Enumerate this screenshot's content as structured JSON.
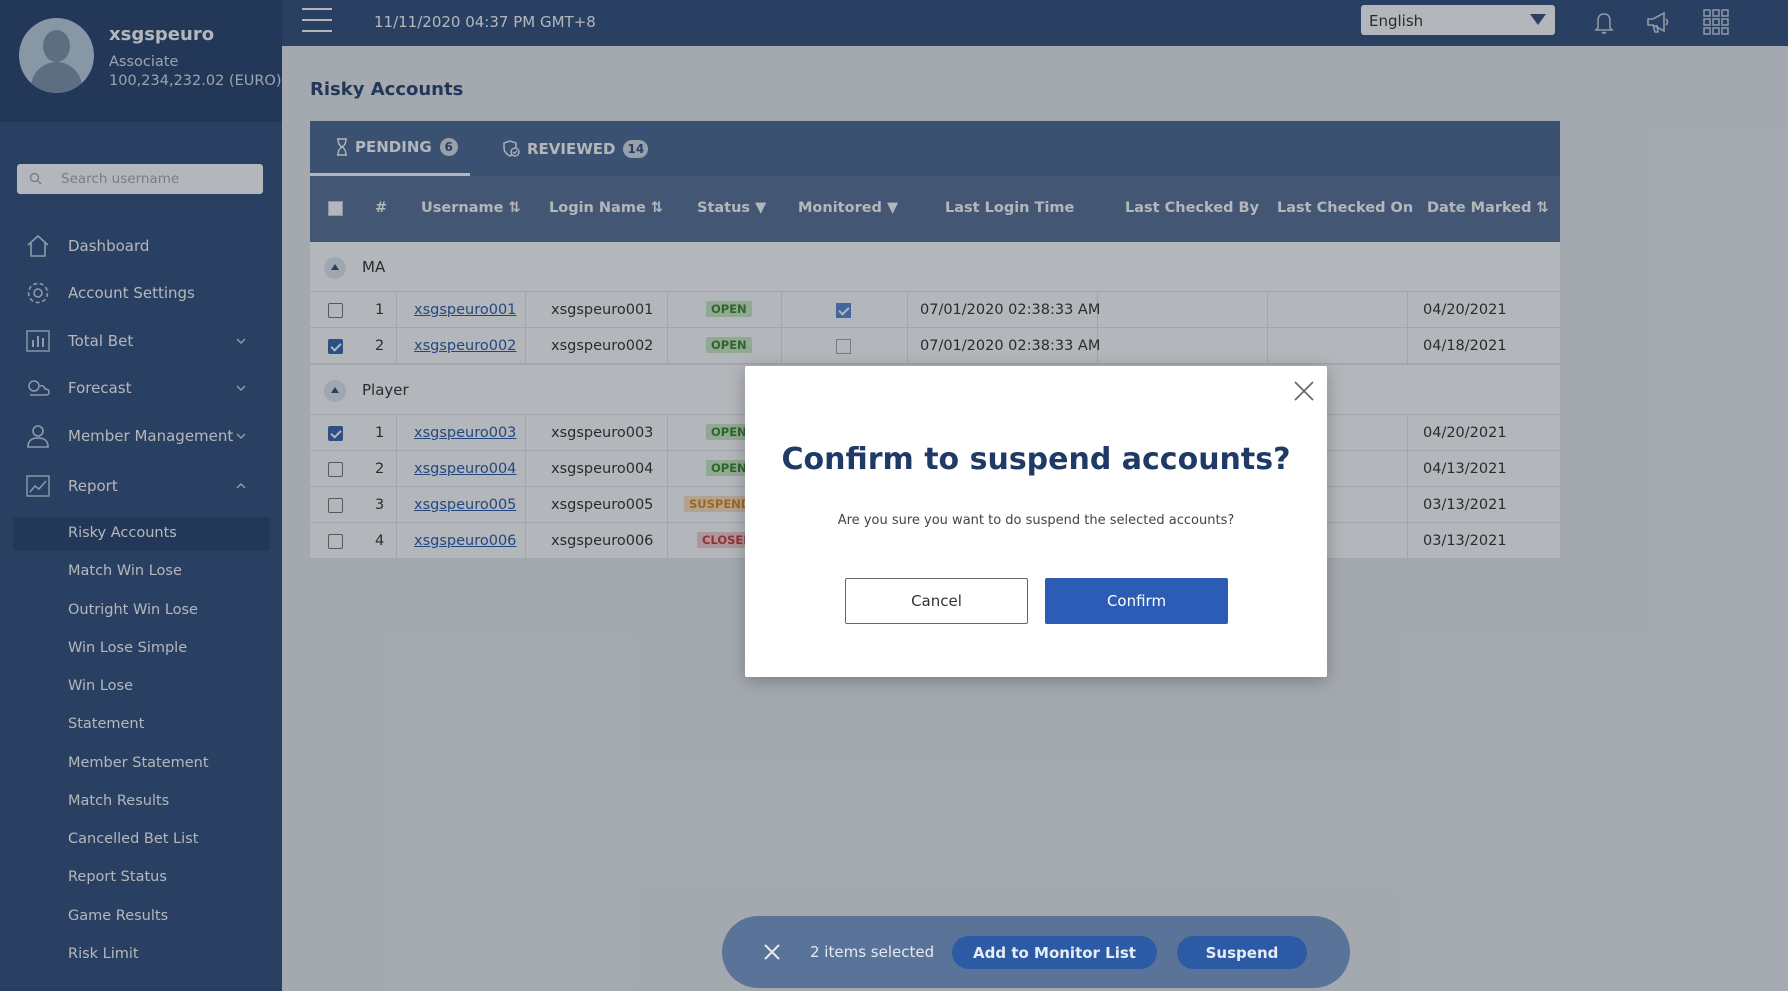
{
  "profile": {
    "name": "xsgspeuro",
    "role": "Associate",
    "balance": "100,234,232.02 (EURO)"
  },
  "search": {
    "placeholder": "Search username"
  },
  "nav": {
    "dashboard": "Dashboard",
    "account_settings": "Account Settings",
    "total_bet": "Total Bet",
    "forecast": "Forecast",
    "member_management": "Member Management",
    "report": "Report"
  },
  "report_items": [
    "Risky Accounts",
    "Match Win Lose",
    "Outright Win Lose",
    "Win Lose Simple",
    "Win Lose",
    "Statement",
    "Member Statement",
    "Match Results",
    "Cancelled Bet List",
    "Report Status",
    "Game Results",
    "Risk Limit"
  ],
  "topbar": {
    "datetime": "11/11/2020 04:37 PM GMT+8",
    "language": "English"
  },
  "page": {
    "title": "Risky Accounts"
  },
  "tabs": {
    "pending": {
      "label": "PENDING",
      "count": "6"
    },
    "reviewed": {
      "label": "REVIEWED",
      "count": "14"
    }
  },
  "columns": {
    "num": "#",
    "username": "Username",
    "login_name": "Login Name",
    "status": "Status",
    "monitored": "Monitored",
    "last_login": "Last Login Time",
    "last_checked_by": "Last Checked By",
    "last_checked_on": "Last Checked On",
    "date_marked": "Date Marked"
  },
  "groups": [
    {
      "name": "MA",
      "rows": [
        {
          "num": "1",
          "username": "xsgspeuro001",
          "login": "xsgspeuro001",
          "status": "OPEN",
          "last_login": "07/01/2020 02:38:33 AM",
          "date_marked": "04/20/2021"
        },
        {
          "num": "2",
          "username": "xsgspeuro002",
          "login": "xsgspeuro002",
          "status": "OPEN",
          "last_login": "07/01/2020 02:38:33 AM",
          "date_marked": "04/18/2021"
        }
      ]
    },
    {
      "name": "Player",
      "rows": [
        {
          "num": "1",
          "username": "xsgspeuro003",
          "login": "xsgspeuro003",
          "status": "OPEN",
          "date_marked": "04/20/2021"
        },
        {
          "num": "2",
          "username": "xsgspeuro004",
          "login": "xsgspeuro004",
          "status": "OPEN",
          "date_marked": "04/13/2021"
        },
        {
          "num": "3",
          "username": "xsgspeuro005",
          "login": "xsgspeuro005",
          "status": "SUSPEND",
          "date_marked": "03/13/2021"
        },
        {
          "num": "4",
          "username": "xsgspeuro006",
          "login": "xsgspeuro006",
          "status": "CLOSED",
          "date_marked": "03/13/2021"
        }
      ]
    }
  ],
  "bottombar": {
    "selected_text": "2 items selected",
    "monitor_label": "Add to Monitor List",
    "suspend_label": "Suspend"
  },
  "modal": {
    "title": "Confirm to suspend accounts?",
    "message": "Are you sure you want to do suspend the selected accounts?",
    "cancel_label": "Cancel",
    "confirm_label": "Confirm"
  },
  "colors": {
    "sidebar": "#35517e",
    "accent": "#2c5cb5",
    "modal_title": "#1f3a66"
  }
}
